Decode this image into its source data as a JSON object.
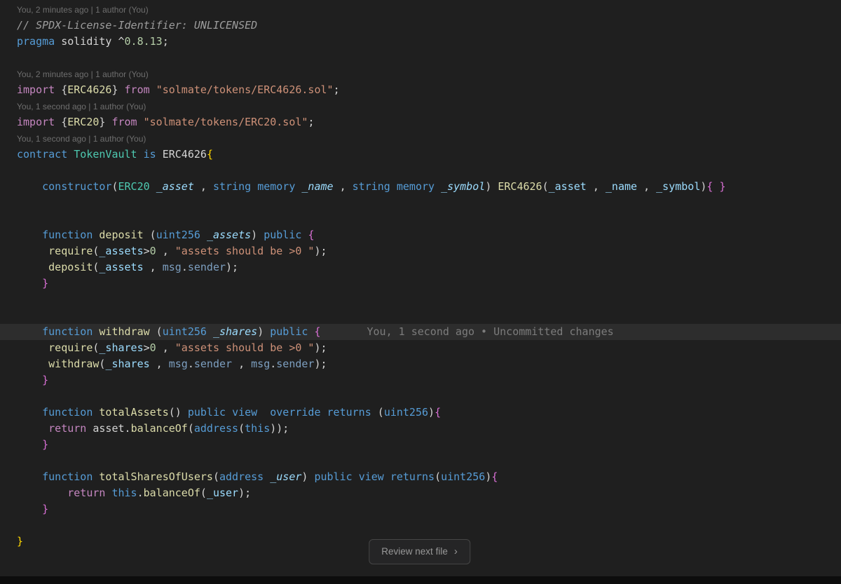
{
  "palette": {
    "background": "#1f1f1f",
    "line_highlight": "#2d2d2d",
    "codelens": "#6e6e6e",
    "inline_blame": "#7c7c7c",
    "comment": "#9d9d9d",
    "keyword": "#569cd6",
    "control": "#c586c0",
    "type": "#4ec9b0",
    "func": "#dcdcaa",
    "var": "#9cdcfe",
    "string": "#ce9178",
    "number": "#b5cea8",
    "text": "#d4d4d4",
    "builtin": "#7d9fc0",
    "brace1": "#ffd700",
    "brace2": "#da70d6",
    "footer_bar": "#0d0d0d",
    "button_bg": "#252526",
    "button_border": "#454545",
    "button_text": "#989898"
  },
  "editor": {
    "lines": [
      {
        "kind": "codelens",
        "text": "You, 2 minutes ago | 1 author (You)"
      },
      {
        "kind": "code",
        "tokens": [
          {
            "t": "// SPDX-License-Identifier: UNLICENSED",
            "s": "comment"
          }
        ]
      },
      {
        "kind": "code",
        "tokens": [
          {
            "t": "pragma",
            "s": "keyword"
          },
          {
            "t": " solidity "
          },
          {
            "t": "^"
          },
          {
            "t": "0.8.13",
            "s": "number"
          },
          {
            "t": ";"
          }
        ]
      },
      {
        "kind": "empty"
      },
      {
        "kind": "codelens",
        "text": "You, 2 minutes ago | 1 author (You)"
      },
      {
        "kind": "code",
        "tokens": [
          {
            "t": "import",
            "s": "control"
          },
          {
            "t": " {"
          },
          {
            "t": "ERC4626",
            "s": "func"
          },
          {
            "t": "} "
          },
          {
            "t": "from",
            "s": "control"
          },
          {
            "t": " "
          },
          {
            "t": "\"solmate/tokens/ERC4626.sol\"",
            "s": "string"
          },
          {
            "t": ";"
          }
        ]
      },
      {
        "kind": "codelens",
        "text": "You, 1 second ago | 1 author (You)"
      },
      {
        "kind": "code",
        "tokens": [
          {
            "t": "import",
            "s": "control"
          },
          {
            "t": " {"
          },
          {
            "t": "ERC20",
            "s": "func"
          },
          {
            "t": "} "
          },
          {
            "t": "from",
            "s": "control"
          },
          {
            "t": " "
          },
          {
            "t": "\"solmate/tokens/ERC20.sol\"",
            "s": "string"
          },
          {
            "t": ";"
          }
        ]
      },
      {
        "kind": "codelens",
        "text": "You, 1 second ago | 1 author (You)"
      },
      {
        "kind": "code",
        "tokens": [
          {
            "t": "contract",
            "s": "keyword"
          },
          {
            "t": " "
          },
          {
            "t": "TokenVault",
            "s": "type"
          },
          {
            "t": " "
          },
          {
            "t": "is",
            "s": "keyword"
          },
          {
            "t": " "
          },
          {
            "t": "ERC4626"
          },
          {
            "t": "{",
            "s": "brace1"
          }
        ]
      },
      {
        "kind": "empty"
      },
      {
        "kind": "code",
        "tokens": [
          {
            "t": "    "
          },
          {
            "t": "constructor",
            "s": "keyword"
          },
          {
            "t": "("
          },
          {
            "t": "ERC20",
            "s": "type"
          },
          {
            "t": " "
          },
          {
            "t": "_asset",
            "s": "param"
          },
          {
            "t": " , "
          },
          {
            "t": "string",
            "s": "keyword"
          },
          {
            "t": " "
          },
          {
            "t": "memory",
            "s": "keyword"
          },
          {
            "t": " "
          },
          {
            "t": "_name",
            "s": "param"
          },
          {
            "t": " , "
          },
          {
            "t": "string",
            "s": "keyword"
          },
          {
            "t": " "
          },
          {
            "t": "memory",
            "s": "keyword"
          },
          {
            "t": " "
          },
          {
            "t": "_symbol",
            "s": "param"
          },
          {
            "t": ") "
          },
          {
            "t": "ERC4626",
            "s": "func"
          },
          {
            "t": "("
          },
          {
            "t": "_asset",
            "s": "var"
          },
          {
            "t": " , "
          },
          {
            "t": "_name",
            "s": "var"
          },
          {
            "t": " , "
          },
          {
            "t": "_symbol",
            "s": "var"
          },
          {
            "t": ")"
          },
          {
            "t": "{ }",
            "s": "brace2"
          }
        ]
      },
      {
        "kind": "empty"
      },
      {
        "kind": "empty"
      },
      {
        "kind": "code",
        "tokens": [
          {
            "t": "    "
          },
          {
            "t": "function",
            "s": "keyword"
          },
          {
            "t": " "
          },
          {
            "t": "deposit",
            "s": "func"
          },
          {
            "t": " ("
          },
          {
            "t": "uint256",
            "s": "keyword"
          },
          {
            "t": " "
          },
          {
            "t": "_assets",
            "s": "param"
          },
          {
            "t": ") "
          },
          {
            "t": "public",
            "s": "keyword"
          },
          {
            "t": " "
          },
          {
            "t": "{",
            "s": "brace2"
          }
        ]
      },
      {
        "kind": "code",
        "tokens": [
          {
            "t": "     "
          },
          {
            "t": "require",
            "s": "func"
          },
          {
            "t": "("
          },
          {
            "t": "_assets",
            "s": "var"
          },
          {
            "t": ">"
          },
          {
            "t": "0",
            "s": "number"
          },
          {
            "t": " , "
          },
          {
            "t": "\"assets should be >0 \"",
            "s": "string"
          },
          {
            "t": ");"
          }
        ]
      },
      {
        "kind": "code",
        "tokens": [
          {
            "t": "     "
          },
          {
            "t": "deposit",
            "s": "func"
          },
          {
            "t": "("
          },
          {
            "t": "_assets",
            "s": "var"
          },
          {
            "t": " , "
          },
          {
            "t": "msg",
            "s": "builtin"
          },
          {
            "t": "."
          },
          {
            "t": "sender",
            "s": "builtin"
          },
          {
            "t": ");"
          }
        ]
      },
      {
        "kind": "code",
        "tokens": [
          {
            "t": "    "
          },
          {
            "t": "}",
            "s": "brace2"
          }
        ]
      },
      {
        "kind": "empty"
      },
      {
        "kind": "empty"
      },
      {
        "kind": "code",
        "highlight": true,
        "annotation": "You, 1 second ago • Uncommitted changes",
        "tokens": [
          {
            "t": "    "
          },
          {
            "t": "function",
            "s": "keyword"
          },
          {
            "t": " "
          },
          {
            "t": "withdraw",
            "s": "func"
          },
          {
            "t": " ("
          },
          {
            "t": "uint256",
            "s": "keyword"
          },
          {
            "t": " "
          },
          {
            "t": "_shares",
            "s": "param"
          },
          {
            "t": ") "
          },
          {
            "t": "public",
            "s": "keyword"
          },
          {
            "t": " "
          },
          {
            "t": "{",
            "s": "brace2"
          }
        ]
      },
      {
        "kind": "code",
        "tokens": [
          {
            "t": "     "
          },
          {
            "t": "require",
            "s": "func"
          },
          {
            "t": "("
          },
          {
            "t": "_shares",
            "s": "var"
          },
          {
            "t": ">"
          },
          {
            "t": "0",
            "s": "number"
          },
          {
            "t": " , "
          },
          {
            "t": "\"assets should be >0 \"",
            "s": "string"
          },
          {
            "t": ");"
          }
        ]
      },
      {
        "kind": "code",
        "tokens": [
          {
            "t": "     "
          },
          {
            "t": "withdraw",
            "s": "func"
          },
          {
            "t": "("
          },
          {
            "t": "_shares",
            "s": "var"
          },
          {
            "t": " , "
          },
          {
            "t": "msg",
            "s": "builtin"
          },
          {
            "t": "."
          },
          {
            "t": "sender",
            "s": "builtin"
          },
          {
            "t": " , "
          },
          {
            "t": "msg",
            "s": "builtin"
          },
          {
            "t": "."
          },
          {
            "t": "sender",
            "s": "builtin"
          },
          {
            "t": ");"
          }
        ]
      },
      {
        "kind": "code",
        "tokens": [
          {
            "t": "    "
          },
          {
            "t": "}",
            "s": "brace2"
          }
        ]
      },
      {
        "kind": "empty"
      },
      {
        "kind": "code",
        "tokens": [
          {
            "t": "    "
          },
          {
            "t": "function",
            "s": "keyword"
          },
          {
            "t": " "
          },
          {
            "t": "totalAssets",
            "s": "func"
          },
          {
            "t": "() "
          },
          {
            "t": "public",
            "s": "keyword"
          },
          {
            "t": " "
          },
          {
            "t": "view",
            "s": "keyword"
          },
          {
            "t": "  "
          },
          {
            "t": "override",
            "s": "keyword"
          },
          {
            "t": " "
          },
          {
            "t": "returns",
            "s": "keyword"
          },
          {
            "t": " ("
          },
          {
            "t": "uint256",
            "s": "keyword"
          },
          {
            "t": ")"
          },
          {
            "t": "{",
            "s": "brace2"
          }
        ]
      },
      {
        "kind": "code",
        "tokens": [
          {
            "t": "     "
          },
          {
            "t": "return",
            "s": "control"
          },
          {
            "t": " "
          },
          {
            "t": "asset"
          },
          {
            "t": "."
          },
          {
            "t": "balanceOf",
            "s": "func"
          },
          {
            "t": "("
          },
          {
            "t": "address",
            "s": "keyword"
          },
          {
            "t": "("
          },
          {
            "t": "this",
            "s": "keyword"
          },
          {
            "t": "));"
          }
        ]
      },
      {
        "kind": "code",
        "tokens": [
          {
            "t": "    "
          },
          {
            "t": "}",
            "s": "brace2"
          }
        ]
      },
      {
        "kind": "empty"
      },
      {
        "kind": "code",
        "tokens": [
          {
            "t": "    "
          },
          {
            "t": "function",
            "s": "keyword"
          },
          {
            "t": " "
          },
          {
            "t": "totalSharesOfUsers",
            "s": "func"
          },
          {
            "t": "("
          },
          {
            "t": "address",
            "s": "keyword"
          },
          {
            "t": " "
          },
          {
            "t": "_user",
            "s": "param"
          },
          {
            "t": ") "
          },
          {
            "t": "public",
            "s": "keyword"
          },
          {
            "t": " "
          },
          {
            "t": "view",
            "s": "keyword"
          },
          {
            "t": " "
          },
          {
            "t": "returns",
            "s": "keyword"
          },
          {
            "t": "("
          },
          {
            "t": "uint256",
            "s": "keyword"
          },
          {
            "t": ")"
          },
          {
            "t": "{",
            "s": "brace2"
          }
        ]
      },
      {
        "kind": "code",
        "tokens": [
          {
            "t": "        "
          },
          {
            "t": "return",
            "s": "control"
          },
          {
            "t": " "
          },
          {
            "t": "this",
            "s": "keyword"
          },
          {
            "t": "."
          },
          {
            "t": "balanceOf",
            "s": "func"
          },
          {
            "t": "("
          },
          {
            "t": "_user",
            "s": "var"
          },
          {
            "t": ");"
          }
        ]
      },
      {
        "kind": "code",
        "tokens": [
          {
            "t": "    "
          },
          {
            "t": "}",
            "s": "brace2"
          }
        ]
      },
      {
        "kind": "empty"
      },
      {
        "kind": "code",
        "tokens": [
          {
            "t": "}",
            "s": "brace1"
          }
        ]
      }
    ]
  },
  "review_button": {
    "label": "Review next file",
    "chevron": "›"
  }
}
